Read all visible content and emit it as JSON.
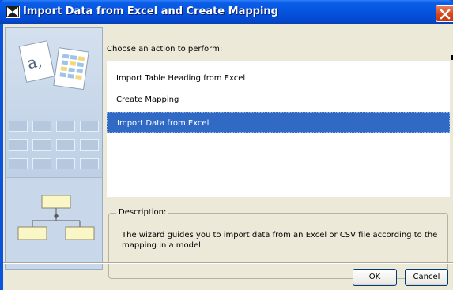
{
  "window": {
    "title": "Import Data from Excel and Create Mapping"
  },
  "illustration": {
    "letter_glyph": "a,"
  },
  "action_panel": {
    "prompt": "Choose an action to perform:",
    "actions": [
      {
        "label": "Import Table Heading from Excel",
        "selected": false
      },
      {
        "label": "Create Mapping",
        "selected": false
      },
      {
        "label": "Import Data from Excel",
        "selected": true
      }
    ]
  },
  "description": {
    "label": "Description:",
    "text": "The wizard guides you to import data from an Excel or CSV file according to the mapping in a model."
  },
  "buttons": {
    "ok_label": "OK",
    "cancel_label": "Cancel"
  },
  "colors": {
    "title_bar": "#0553de",
    "selection": "#316ac5",
    "dialog_bg": "#ece9d8"
  },
  "icons": {
    "title": "app-window-icon",
    "close": "close-icon",
    "illustration_top": "document-spreadsheet-icon",
    "illustration_bottom": "hierarchy-diagram-icon"
  }
}
